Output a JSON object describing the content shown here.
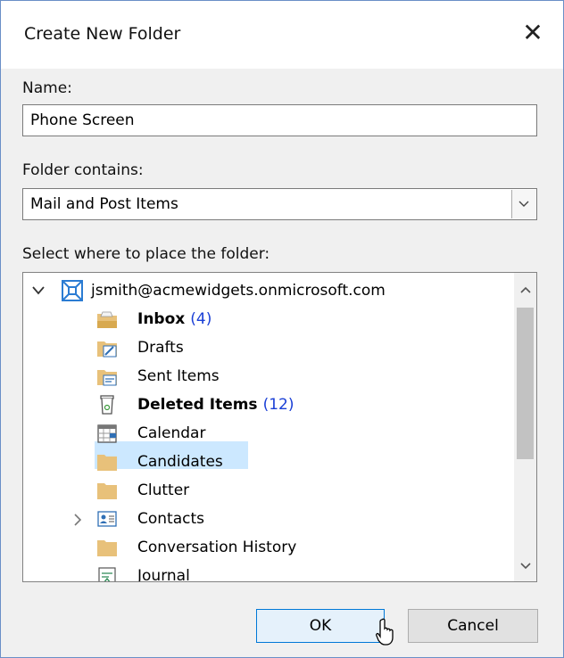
{
  "dialog": {
    "title": "Create New Folder",
    "close_glyph": "✕"
  },
  "name": {
    "label": "Name:",
    "value": "Phone Screen"
  },
  "contains": {
    "label": "Folder contains:",
    "value": "Mail and Post Items"
  },
  "location": {
    "label": "Select where to place the folder:",
    "account": "jsmith@acmewidgets.onmicrosoft.com",
    "folders": [
      {
        "label": "Inbox",
        "count": "(4)",
        "icon": "inbox-icon"
      },
      {
        "label": "Drafts",
        "icon": "drafts-icon"
      },
      {
        "label": "Sent Items",
        "icon": "sent-items-icon"
      },
      {
        "label": "Deleted Items",
        "count": "(12)",
        "icon": "trash-icon"
      },
      {
        "label": "Calendar",
        "icon": "calendar-icon"
      },
      {
        "label": "Candidates",
        "icon": "folder-icon",
        "selected": true
      },
      {
        "label": "Clutter",
        "icon": "folder-icon"
      },
      {
        "label": "Contacts",
        "icon": "contacts-icon"
      },
      {
        "label": "Conversation History",
        "icon": "folder-icon"
      },
      {
        "label": "Journal",
        "icon": "journal-icon"
      }
    ]
  },
  "buttons": {
    "ok": "OK",
    "cancel": "Cancel"
  },
  "colors": {
    "accent": "#0078d7",
    "selection": "#cce8ff",
    "count": "#1a3fd6",
    "folder": "#e8c17a"
  }
}
